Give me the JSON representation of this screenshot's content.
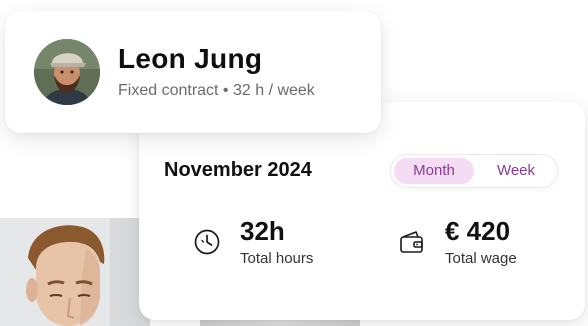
{
  "profile": {
    "name": "Leon Jung",
    "subtitle": "Fixed contract • 32 h / week"
  },
  "summary": {
    "period": "November 2024",
    "toggle": {
      "options": [
        "Month",
        "Week"
      ],
      "selected": "Month",
      "accent_text_color": "#8b3a98",
      "active_background": "#f4dcf5"
    },
    "stats": [
      {
        "icon": "clock-icon",
        "value": "32h",
        "label": "Total hours"
      },
      {
        "icon": "wallet-icon",
        "value": "€ 420",
        "label": "Total wage"
      }
    ]
  }
}
